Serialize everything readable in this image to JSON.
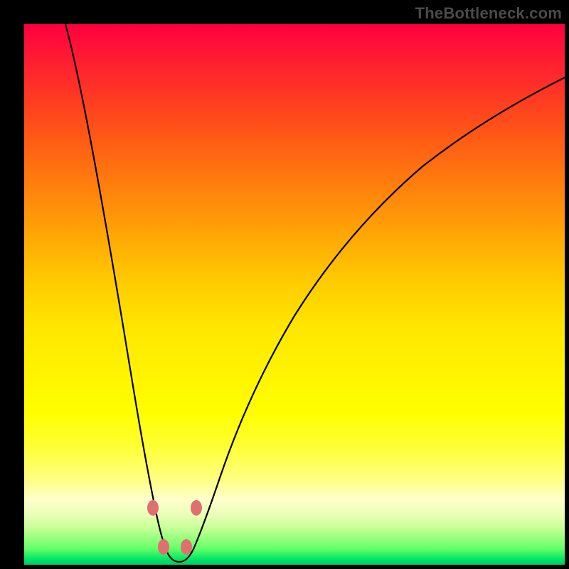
{
  "watermark": "TheBottleneck.com",
  "chart_data": {
    "type": "line",
    "title": "",
    "xlabel": "",
    "ylabel": "",
    "xlim": [
      0,
      100
    ],
    "ylim": [
      0,
      100
    ],
    "grid": false,
    "series": [
      {
        "name": "bottleneck-curve",
        "x": [
          8,
          12,
          15,
          18,
          20,
          22,
          23.5,
          24.5,
          25.5,
          27,
          29,
          30,
          31,
          33,
          36,
          40,
          46,
          52,
          60,
          70,
          80,
          90,
          100
        ],
        "y": [
          100,
          75,
          55,
          38,
          27,
          17,
          10,
          6,
          3,
          1,
          1,
          3,
          6,
          12,
          22,
          33,
          46,
          55,
          65,
          74,
          81,
          86,
          90
        ]
      }
    ],
    "markers": [
      {
        "name": "marker-left-upper",
        "x": 23.5,
        "y": 10,
        "color": "#e57373"
      },
      {
        "name": "marker-left-lower",
        "x": 25,
        "y": 3,
        "color": "#e57373"
      },
      {
        "name": "marker-right-lower",
        "x": 29.5,
        "y": 3,
        "color": "#e57373"
      },
      {
        "name": "marker-right-upper",
        "x": 31,
        "y": 10,
        "color": "#e57373"
      }
    ],
    "background_gradient": {
      "top": "#ff0040",
      "mid_upper": "#ff8000",
      "mid": "#ffff00",
      "mid_lower": "#e6ff99",
      "bottom": "#00cc66"
    }
  }
}
